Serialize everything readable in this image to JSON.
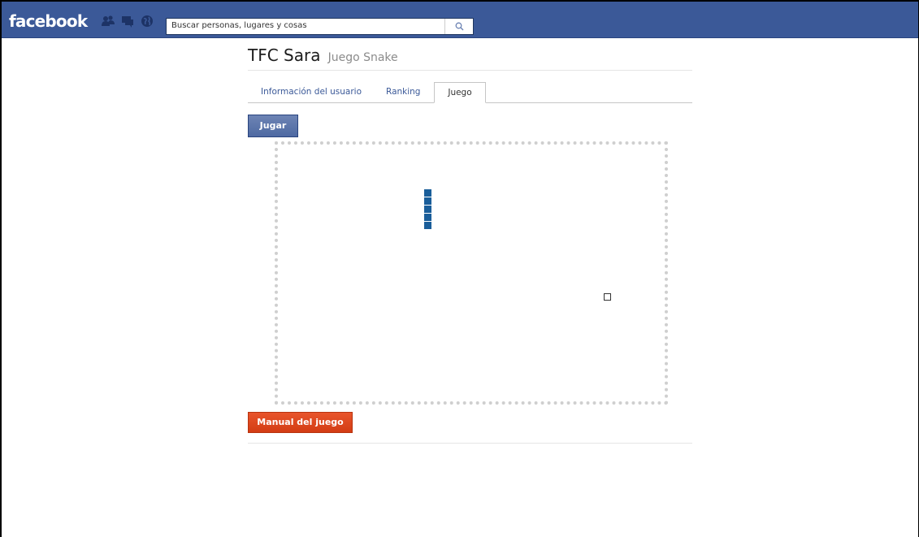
{
  "topbar": {
    "logo": "facebook",
    "jewels": [
      "friends-icon",
      "messages-icon",
      "notifications-icon"
    ],
    "search_placeholder": "Buscar personas, lugares y cosas",
    "brand_color": "#3b5998"
  },
  "page": {
    "title": "TFC Sara",
    "subtitle": "Juego Snake"
  },
  "tabs": [
    {
      "label": "Información del usuario",
      "active": false
    },
    {
      "label": "Ranking",
      "active": false
    },
    {
      "label": "Juego",
      "active": true
    }
  ],
  "buttons": {
    "play": "Jugar",
    "manual": "Manual del juego"
  },
  "game": {
    "snake_color": "#1a5e9a",
    "snake_length": 5
  }
}
